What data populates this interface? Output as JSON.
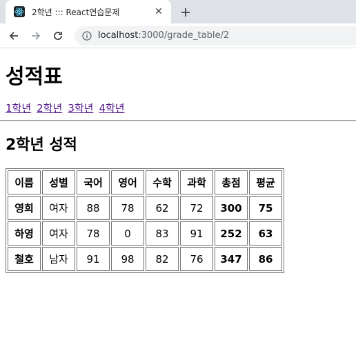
{
  "browser": {
    "tab_title": "2학년 ::: React연습문제",
    "url_host": "localhost",
    "url_rest": ":3000/grade_table/2"
  },
  "page": {
    "title": "성적표",
    "grade_links": [
      "1학년",
      "2학년",
      "3학년",
      "4학년"
    ],
    "subtitle": "2학년 성적"
  },
  "table": {
    "headers": [
      "이름",
      "성별",
      "국어",
      "영어",
      "수학",
      "과학",
      "총점",
      "평균"
    ],
    "rows": [
      [
        "영희",
        "여자",
        "88",
        "78",
        "62",
        "72",
        "300",
        "75"
      ],
      [
        "하영",
        "여자",
        "78",
        "0",
        "83",
        "91",
        "252",
        "63"
      ],
      [
        "철호",
        "남자",
        "91",
        "98",
        "82",
        "76",
        "347",
        "86"
      ]
    ]
  }
}
